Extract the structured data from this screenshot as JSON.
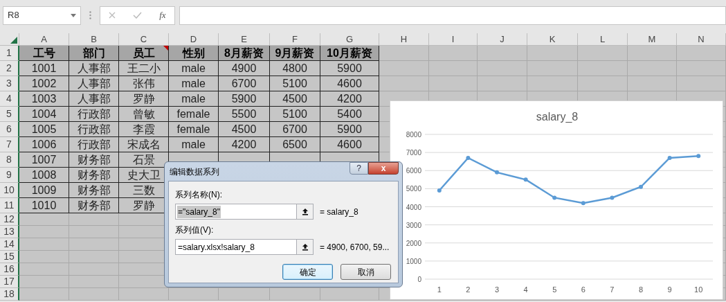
{
  "name_box": {
    "value": "R8"
  },
  "formula_bar": {
    "function_label": "fx"
  },
  "sheet": {
    "columns": [
      "A",
      "B",
      "C",
      "D",
      "E",
      "F",
      "G",
      "H",
      "I",
      "J",
      "K",
      "L",
      "M",
      "N"
    ],
    "row_numbers": [
      "1",
      "2",
      "3",
      "4",
      "5",
      "6",
      "7",
      "8",
      "9",
      "10",
      "11",
      "12",
      "13",
      "14",
      "15",
      "16",
      "17",
      "18"
    ],
    "header": [
      {
        "text": "工号",
        "comment": false
      },
      {
        "text": "部门",
        "comment": false
      },
      {
        "text": "员工",
        "comment": true
      },
      {
        "text": "性别",
        "comment": false
      },
      {
        "text": "8月薪资",
        "comment": false
      },
      {
        "text": "9月薪资",
        "comment": false
      },
      {
        "text": "10月薪资",
        "comment": false
      }
    ],
    "rows": [
      [
        "1001",
        "人事部",
        "王二小",
        "male",
        "4900",
        "4800",
        "5900"
      ],
      [
        "1002",
        "人事部",
        "张伟",
        "male",
        "6700",
        "5100",
        "4600"
      ],
      [
        "1003",
        "人事部",
        "罗静",
        "male",
        "5900",
        "4500",
        "4200"
      ],
      [
        "1004",
        "行政部",
        "曾敏",
        "female",
        "5500",
        "5100",
        "5400"
      ],
      [
        "1005",
        "行政部",
        "李霞",
        "female",
        "4500",
        "6700",
        "5900"
      ],
      [
        "1006",
        "行政部",
        "宋成名",
        "male",
        "4200",
        "6500",
        "4600"
      ],
      [
        "1007",
        "财务部",
        "石景"
      ],
      [
        "1008",
        "财务部",
        "史大卫"
      ],
      [
        "1009",
        "财务部",
        "三数"
      ],
      [
        "1010",
        "财务部",
        "罗静"
      ]
    ]
  },
  "chart": {
    "chart_data": {
      "type": "line",
      "title": "salary_8",
      "categories": [
        "1",
        "2",
        "3",
        "4",
        "5",
        "6",
        "7",
        "8",
        "9",
        "10"
      ],
      "grid": true,
      "series": [
        {
          "marker": true,
          "color": "#5b9bd5",
          "values": [
            4900,
            6700,
            5900,
            5500,
            4500,
            4200,
            4500,
            5100,
            6700,
            6800
          ]
        }
      ],
      "ylim": [
        0,
        8000
      ],
      "yticks": [
        0,
        1000,
        2000,
        3000,
        4000,
        5000,
        6000,
        7000,
        8000
      ]
    }
  },
  "dialog": {
    "title": "编辑数据系列",
    "help": "?",
    "close": "x",
    "fields": [
      {
        "label": "系列名称(N):",
        "value": "=\"salary_8\"",
        "selected": true,
        "preview": "= salary_8"
      },
      {
        "label": "系列值(V):",
        "value": "=salary.xlsx!salary_8",
        "selected": false,
        "preview": "= 4900, 6700, 59..."
      }
    ],
    "buttons": [
      {
        "label": "确定",
        "default": true
      },
      {
        "label": "取消",
        "default": false
      }
    ]
  }
}
